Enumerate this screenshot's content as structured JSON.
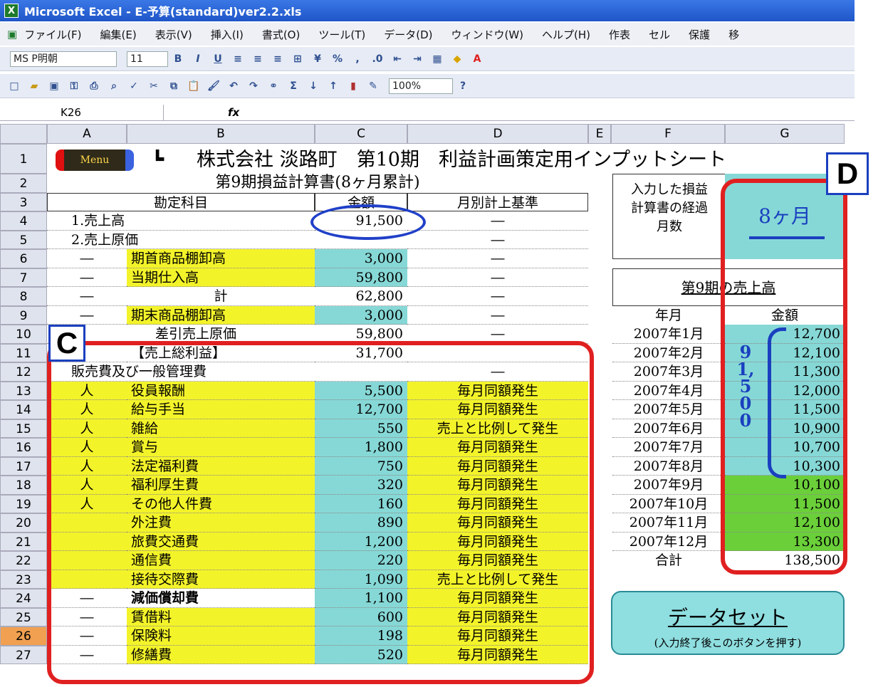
{
  "window": {
    "title": "Microsoft Excel - E-予算(standard)ver2.2.xls"
  },
  "menu": [
    "ファイル(F)",
    "編集(E)",
    "表示(V)",
    "挿入(I)",
    "書式(O)",
    "ツール(T)",
    "データ(D)",
    "ウィンドウ(W)",
    "ヘルプ(H)",
    "作表",
    "セル",
    "保護",
    "移"
  ],
  "toolbar": {
    "font": "MS P明朝",
    "size": "11",
    "zoom": "100%"
  },
  "formula": {
    "cell": "K26",
    "fx": "fx"
  },
  "columns": [
    "A",
    "B",
    "C",
    "D",
    "E",
    "F",
    "G"
  ],
  "rows": [
    "1",
    "2",
    "3",
    "4",
    "5",
    "6",
    "7",
    "8",
    "9",
    "10",
    "11",
    "12",
    "13",
    "14",
    "15",
    "16",
    "17",
    "18",
    "19",
    "20",
    "21",
    "22",
    "23",
    "24",
    "25",
    "26",
    "27"
  ],
  "sheet": {
    "menu_button": "Menu",
    "title": "株式会社 淡路町　第10期　利益計画策定用インプットシート",
    "pl_title": "第9期損益計算書(8ヶ月累計)",
    "headers": [
      "勘定科目",
      "金額",
      "月別計上基準"
    ],
    "rows": [
      {
        "a": "",
        "b": "1.売上高",
        "c": "91,500",
        "d": "―"
      },
      {
        "a": "",
        "b": "2.売上原価",
        "c": "",
        "d": "―"
      },
      {
        "a": "―",
        "b": "期首商品棚卸高",
        "c": "3,000",
        "d": "―"
      },
      {
        "a": "―",
        "b": "当期仕入高",
        "c": "59,800",
        "d": "―"
      },
      {
        "a": "―",
        "b": "計",
        "c": "62,800",
        "d": "―"
      },
      {
        "a": "―",
        "b": "期末商品棚卸高",
        "c": "3,000",
        "d": "―"
      },
      {
        "a": "",
        "b": "差引売上原価",
        "c": "59,800",
        "d": "―"
      },
      {
        "a": "",
        "b": "【売上総利益】",
        "c": "31,700",
        "d": ""
      },
      {
        "a": "",
        "b": "販売費及び一般管理費",
        "c": "",
        "d": "―"
      },
      {
        "a": "人",
        "b": "役員報酬",
        "c": "5,500",
        "d": "毎月同額発生"
      },
      {
        "a": "人",
        "b": "給与手当",
        "c": "12,700",
        "d": "毎月同額発生"
      },
      {
        "a": "人",
        "b": "雑給",
        "c": "550",
        "d": "売上と比例して発生"
      },
      {
        "a": "人",
        "b": "賞与",
        "c": "1,800",
        "d": "毎月同額発生"
      },
      {
        "a": "人",
        "b": "法定福利費",
        "c": "750",
        "d": "毎月同額発生"
      },
      {
        "a": "人",
        "b": "福利厚生費",
        "c": "320",
        "d": "毎月同額発生"
      },
      {
        "a": "人",
        "b": "その他人件費",
        "c": "160",
        "d": "毎月同額発生"
      },
      {
        "a": "",
        "b": "外注費",
        "c": "890",
        "d": "毎月同額発生"
      },
      {
        "a": "",
        "b": "旅費交通費",
        "c": "1,200",
        "d": "毎月同額発生"
      },
      {
        "a": "",
        "b": "通信費",
        "c": "220",
        "d": "毎月同額発生"
      },
      {
        "a": "",
        "b": "接待交際費",
        "c": "1,090",
        "d": "売上と比例して発生"
      },
      {
        "a": "―",
        "b": "減価償却費",
        "c": "1,100",
        "d": "毎月同額発生"
      },
      {
        "a": "―",
        "b": "賃借料",
        "c": "600",
        "d": "毎月同額発生"
      },
      {
        "a": "―",
        "b": "保険料",
        "c": "198",
        "d": "毎月同額発生"
      },
      {
        "a": "―",
        "b": "修繕費",
        "c": "520",
        "d": "毎月同額発生"
      }
    ],
    "months_label_lines": [
      "入力した損益",
      "計算書の経過",
      "月数"
    ],
    "months_value": "8ヶ月",
    "sales_title": "第9期の売上高",
    "sales_headers": [
      "年月",
      "金額"
    ],
    "sales": [
      {
        "ym": "2007年1月",
        "v": "12,700"
      },
      {
        "ym": "2007年2月",
        "v": "12,100"
      },
      {
        "ym": "2007年3月",
        "v": "11,300"
      },
      {
        "ym": "2007年4月",
        "v": "12,000"
      },
      {
        "ym": "2007年5月",
        "v": "11,500"
      },
      {
        "ym": "2007年6月",
        "v": "10,900"
      },
      {
        "ym": "2007年7月",
        "v": "10,700"
      },
      {
        "ym": "2007年8月",
        "v": "10,300"
      },
      {
        "ym": "2007年9月",
        "v": "10,100"
      },
      {
        "ym": "2007年10月",
        "v": "11,500"
      },
      {
        "ym": "2007年11月",
        "v": "12,100"
      },
      {
        "ym": "2007年12月",
        "v": "13,300"
      }
    ],
    "total_label": "合計",
    "total": "138,500",
    "brace_label": "91,500",
    "button_title": "データセット",
    "button_sub": "(入力終了後このボタンを押す)",
    "tag_c": "C",
    "tag_d": "D"
  }
}
